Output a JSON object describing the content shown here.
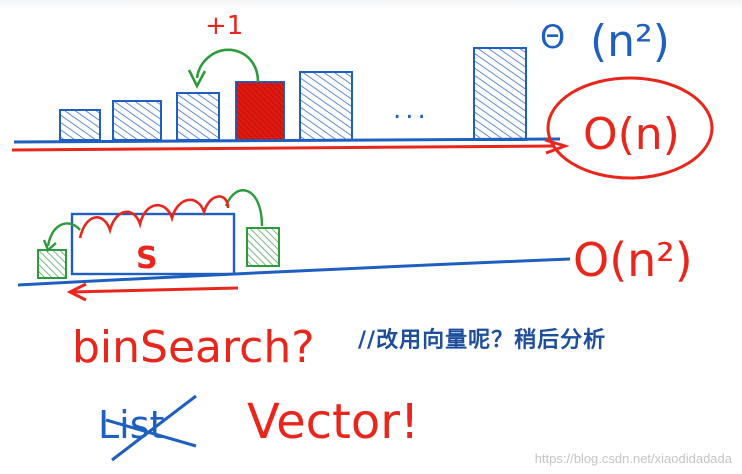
{
  "top": {
    "increment": "+1",
    "dots": "...",
    "theta_symbol": "Θ",
    "theta_complexity": "(n²)",
    "circled_complexity": "O(n)"
  },
  "middle": {
    "block_label": "S",
    "complexity": "O(n²)"
  },
  "bottom": {
    "question": "binSearch?",
    "note": "//改用向量呢？稍后分析",
    "crossed_word": "List",
    "answer": "Vector!"
  },
  "watermark": "https://blog.csdn.net/xiaodidadada",
  "colors": {
    "ink_red": "#e8261c",
    "ink_blue": "#1f5fbf",
    "ink_green": "#2e9a3e",
    "note_blue": "#1f4f9c"
  }
}
